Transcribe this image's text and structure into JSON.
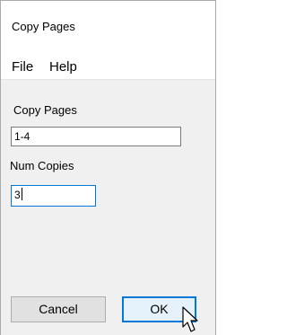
{
  "window": {
    "title": "Copy Pages"
  },
  "menu": {
    "items": [
      "File",
      "Help"
    ]
  },
  "form": {
    "pages_label": "Copy Pages",
    "pages_value": "1-4",
    "copies_label": "Num Copies",
    "copies_value": "3"
  },
  "buttons": {
    "cancel_label": "Cancel",
    "ok_label": "OK"
  },
  "colors": {
    "focus_accent": "#0078d7",
    "client_background": "#f0f0f0"
  },
  "icons": {
    "cursor": "arrow-cursor-icon"
  }
}
